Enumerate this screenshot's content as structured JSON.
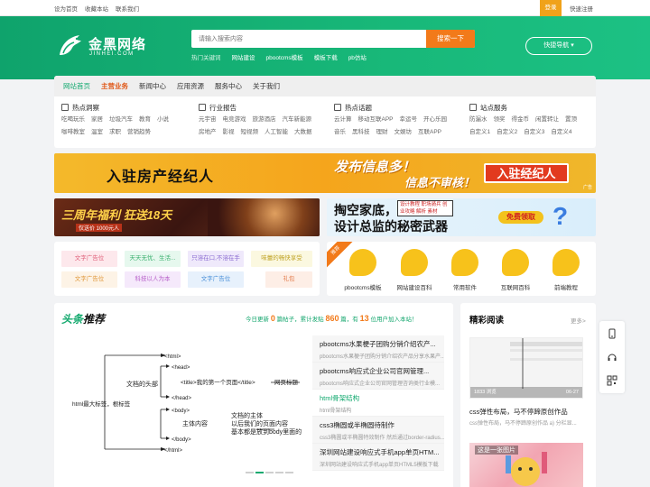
{
  "topbar": {
    "links": [
      "设为首页",
      "收藏本站",
      "联系我们"
    ],
    "login": "登录",
    "register": "快速注册"
  },
  "header": {
    "logo_name": "金黑网络",
    "logo_en": "JINHEI.COM",
    "search_placeholder": "请输入搜索内容",
    "search_button": "搜索一下",
    "hot_label": "热门关键词",
    "hot_keywords": [
      "网站建设",
      "pbootcms模板",
      "模板下载",
      "pb仿站"
    ],
    "quick_nav": "快捷导航 ▾"
  },
  "nav": [
    "网站首页",
    "主营业务",
    "新闻中心",
    "应用资源",
    "服务中心",
    "关于我们"
  ],
  "categories": [
    {
      "title": "热点洞察",
      "row1": [
        "吃喝玩乐",
        "家居",
        "垃圾汽车",
        "教育",
        "小说"
      ],
      "row2": [
        "咖啡教室",
        "温室",
        "求职",
        "营销趋势"
      ]
    },
    {
      "title": "行业报告",
      "row1": [
        "元宇宙",
        "电竞游戏",
        "旅游酒店",
        "汽车新能源"
      ],
      "row2": [
        "房地产",
        "影视",
        "短视频",
        "人工智能",
        "大数据"
      ]
    },
    {
      "title": "热点话题",
      "row1": [
        "云计算",
        "移动互联APP",
        "幸运号",
        "开心乐园"
      ],
      "row2": [
        "音乐",
        "黑科技",
        "理财",
        "文娱坊",
        "互联APP"
      ]
    },
    {
      "title": "站点服务",
      "row1": [
        "防漏水",
        "领奖",
        "得金币",
        "闲置转让",
        "置顶"
      ],
      "row2": [
        "自定义1",
        "自定义2",
        "自定义3",
        "自定义4"
      ]
    }
  ],
  "banner1": {
    "left": "入驻房产经纪人",
    "mid1": "发布信息多！",
    "mid2": "信息不审核！",
    "button": "入驻经纪人",
    "corner": "广告"
  },
  "banner2": {
    "title": "三周年福利 狂送18天",
    "sub": "仅送价 1000元人"
  },
  "banner3": {
    "line1": "掏空家底，",
    "line2": "设计总监的秘密武器",
    "box": "设计教程 职场骑兵 创业攻略 解析 素材",
    "button": "免费领取",
    "q": "?"
  },
  "text_ads": [
    {
      "label": "文字广告位",
      "bg": "#fde8ec",
      "fg": "#e0607a"
    },
    {
      "label": "天天无忧、生活...",
      "bg": "#e6f8ee",
      "fg": "#3bb06f"
    },
    {
      "label": "只溶在口,不溶在手",
      "bg": "#efe9fb",
      "fg": "#8a6ad1"
    },
    {
      "label": "味蕾的畅快享受",
      "bg": "#fbf8e0",
      "fg": "#c0a324"
    },
    {
      "label": "文字广告位",
      "bg": "#fdf3e6",
      "fg": "#e0973a"
    },
    {
      "label": "科技以人为本",
      "bg": "#f5e9fb",
      "fg": "#b760c9"
    },
    {
      "label": "文字广告位",
      "bg": "#e7f1fc",
      "fg": "#4a8fd8"
    },
    {
      "label": "礼包",
      "bg": "#fdeee6",
      "fg": "#e27b4b"
    }
  ],
  "recommend_ribbon": "推荐",
  "icon_links": [
    "pbootcms模板",
    "网站建设百科",
    "常用软件",
    "互联网百科",
    "前端教程"
  ],
  "headline": {
    "title_a": "头条",
    "title_b": "推荐",
    "stats_prefix": "今日更新",
    "today": "0",
    "stats_mid1": "篇帖子，累计发贴",
    "total": "860",
    "stats_mid2": "篇，有",
    "online": "13",
    "stats_suffix": "位用户加入本站！"
  },
  "diagram": {
    "html_open": "<html>",
    "head_open": "<head>",
    "title_tag": "<title>我的第一个页面</title>",
    "arrow_title": "网页标题",
    "head_close": "</head>",
    "body_open": "<body>",
    "body_close": "</body>",
    "html_close": "</html>",
    "doc_head": "文档的头部",
    "root_label": "html最大标签，根标签",
    "main": "主体内容",
    "body_desc1": "文档的主体",
    "body_desc2": "以后我们的页面内容",
    "body_desc3": "基本都是放到body里面的"
  },
  "articles": [
    {
      "title": "pbootcms水果梗子团购分销介绍农产...",
      "desc": "pbootcms水果梗子团购分销介绍农产品分享水果产...",
      "active": false
    },
    {
      "title": "pbootcms响应式企业公司官网管理...",
      "desc": "pbootcms响应式企业公司官网管理咨询类行业模...",
      "active": false
    },
    {
      "title": "html骨架结构",
      "desc": "html骨架结构",
      "active": true
    },
    {
      "title": "css3椭圆或半椭圆待制作",
      "desc": "css3椭圆或半椭圆特效制作 然后通过border-radius...",
      "active": false
    },
    {
      "title": "深圳网站建设响应式手机app单页HTM...",
      "desc": "深圳网站建设响应式手机app单页HTML5模板下载",
      "active": false
    }
  ],
  "featured": {
    "title": "精彩阅读",
    "more": "更多>",
    "img1_views": "1833 浏览",
    "img1_date": "06-27",
    "post_title": "css弹性布局，马不停蹄原创作品",
    "post_desc": "css弹性布局，马不停蹄原创作品 a) 分栏显...",
    "img2_caption": "这是一张图片"
  },
  "colors": {
    "brand": "#12a96f",
    "accent": "#f27a1a",
    "login_bg": "#f0a21a"
  }
}
